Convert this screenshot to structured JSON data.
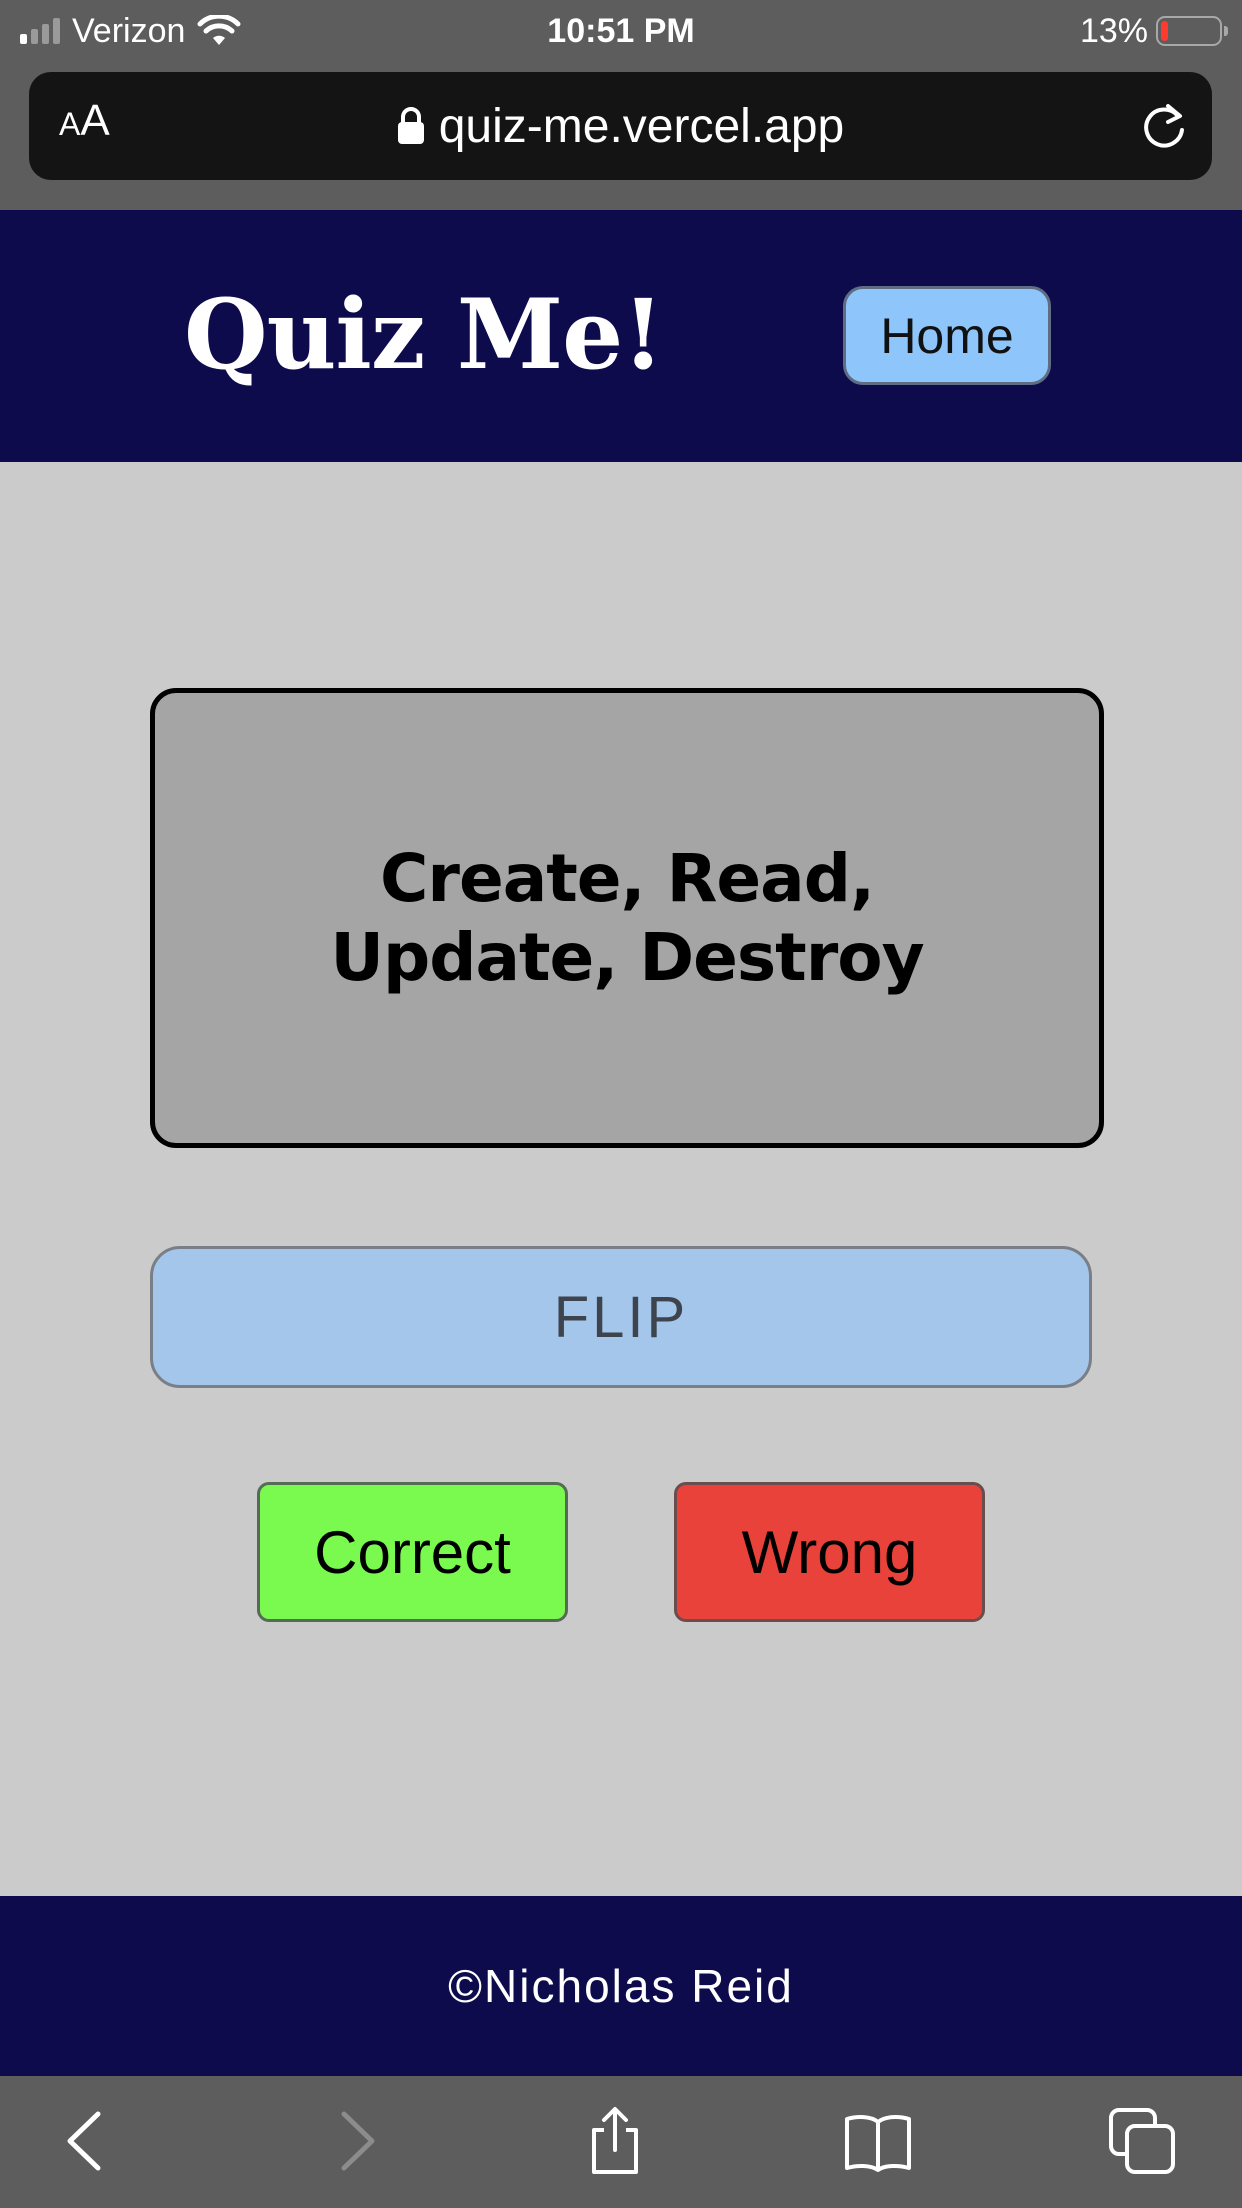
{
  "status_bar": {
    "carrier": "Verizon",
    "time": "10:51 PM",
    "battery_percent": "13%",
    "battery_level": 0.13,
    "signal_bars_active": 1
  },
  "browser": {
    "text_size_small": "A",
    "text_size_big": "A",
    "url": "quiz-me.vercel.app"
  },
  "header": {
    "title": "Quiz Me!",
    "home_label": "Home"
  },
  "card": {
    "text": "Create, Read, Update, Destroy"
  },
  "actions": {
    "flip_label": "FLIP",
    "correct_label": "Correct",
    "wrong_label": "Wrong"
  },
  "footer": {
    "text": "©Nicholas Reid"
  },
  "colors": {
    "header_bg": "#0d0b4c",
    "main_bg": "#cbcbcb",
    "card_bg": "#a5a5a5",
    "home_btn": "#8ec5fa",
    "flip_btn": "#a4c6eb",
    "correct_btn": "#7afa4f",
    "wrong_btn": "#e8423a",
    "browser_chrome": "#5d5d5d"
  },
  "toolbar_icons": [
    "back-icon",
    "forward-icon",
    "share-icon",
    "bookmarks-icon",
    "tabs-icon"
  ]
}
